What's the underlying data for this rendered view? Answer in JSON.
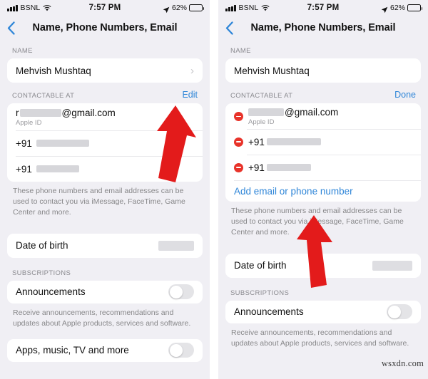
{
  "status_bar": {
    "carrier": "BSNL",
    "time": "7:57 PM",
    "battery_percent": "62%",
    "wifi_icon": "wifi-icon",
    "location_icon": "location-arrow-icon",
    "signal_icon": "signal-bars-icon"
  },
  "nav": {
    "title": "Name, Phone Numbers, Email",
    "back_icon": "chevron-left-icon"
  },
  "left_panel": {
    "name_section": {
      "label": "NAME",
      "value": "Mehvish Mushtaq",
      "chevron_icon": "chevron-right-icon"
    },
    "contactable_section": {
      "label": "CONTACTABLE AT",
      "action": "Edit",
      "email_suffix": "@gmail.com",
      "email_sub": "Apple ID",
      "phone_prefix": "+91",
      "footnote": "These phone numbers and email addresses can be used to contact you via iMessage, FaceTime, Game Center and more."
    },
    "dob_row": {
      "label": "Date of birth"
    },
    "subscriptions": {
      "label": "SUBSCRIPTIONS",
      "announcements_label": "Announcements",
      "announcements_footnote": "Receive announcements, recommendations and updates about Apple products, services and software.",
      "apps_label": "Apps, music, TV and more"
    }
  },
  "right_panel": {
    "name_section": {
      "label": "NAME",
      "value": "Mehvish Mushtaq"
    },
    "contactable_section": {
      "label": "CONTACTABLE AT",
      "action": "Done",
      "email_suffix": "@gmail.com",
      "email_sub": "Apple ID",
      "phone_prefix": "+91",
      "add_link": "Add email or phone number",
      "footnote": "These phone numbers and email addresses can be used to contact you via iMessage, FaceTime, Game Center and more.",
      "delete_icon": "minus-circle-icon"
    },
    "dob_row": {
      "label": "Date of birth"
    },
    "subscriptions": {
      "label": "SUBSCRIPTIONS",
      "announcements_label": "Announcements",
      "announcements_footnote": "Receive announcements, recommendations and updates about Apple products, services and software."
    }
  },
  "annotations": {
    "left_arrow_icon": "red-arrow-pointing-to-edit",
    "right_arrow_icon": "red-arrow-pointing-to-add-link"
  },
  "watermark": "wsxdn.com",
  "colors": {
    "accent_blue": "#2f86d8",
    "delete_red": "#e8332a",
    "arrow_red": "#e31b1b",
    "page_background": "#f0eff4",
    "card_background": "#ffffff"
  }
}
